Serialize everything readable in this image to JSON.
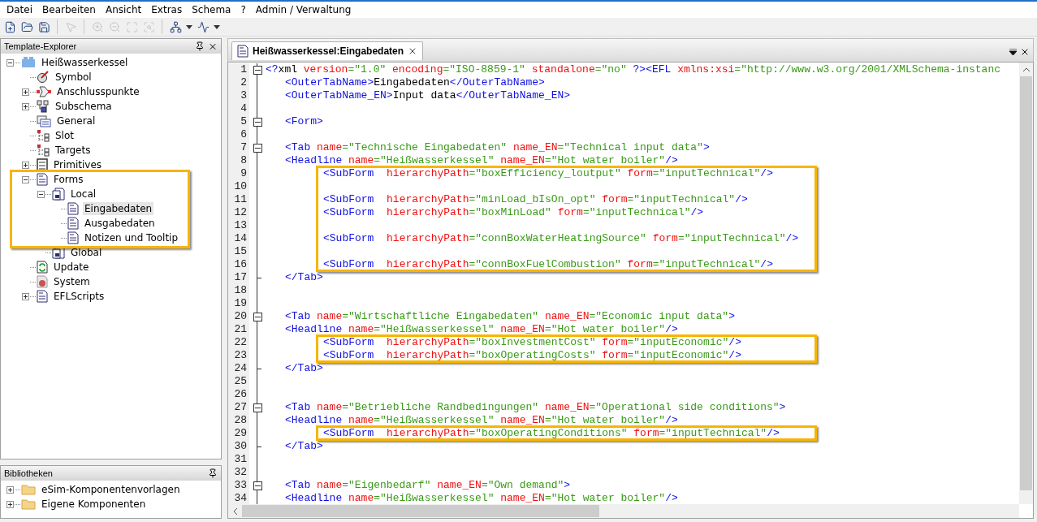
{
  "menu": [
    "Datei",
    "Bearbeiten",
    "Ansicht",
    "Extras",
    "Schema",
    "?",
    "Admin / Verwaltung"
  ],
  "toolbar": [
    {
      "kind": "new",
      "disabled": false
    },
    {
      "kind": "open",
      "disabled": false
    },
    {
      "kind": "save",
      "disabled": false
    },
    {
      "kind": "separator"
    },
    {
      "kind": "pointer",
      "disabled": true
    },
    {
      "kind": "separator"
    },
    {
      "kind": "zoom-in",
      "disabled": true
    },
    {
      "kind": "zoom-out",
      "disabled": true
    },
    {
      "kind": "fit",
      "disabled": true
    },
    {
      "kind": "zoom-area",
      "disabled": true
    },
    {
      "kind": "separator"
    },
    {
      "kind": "layout",
      "disabled": false
    },
    {
      "kind": "dropdown",
      "disabled": false
    },
    {
      "kind": "wave",
      "disabled": false
    },
    {
      "kind": "dropdown",
      "disabled": false
    }
  ],
  "explorer": {
    "title": "Template-Explorer",
    "items": [
      {
        "label": "Heißwasserkessel",
        "kind": "package",
        "expanded": true,
        "selected": false,
        "highlighted": false,
        "children": [
          {
            "label": "Symbol",
            "kind": "symbol",
            "selected": false,
            "highlighted": false
          },
          {
            "label": "Anschlusspunkte",
            "kind": "connector",
            "expanded": false,
            "selected": false,
            "highlighted": false
          },
          {
            "label": "Subschema",
            "kind": "subschema",
            "expanded": false,
            "selected": false,
            "highlighted": false
          },
          {
            "label": "General",
            "kind": "general",
            "selected": false,
            "highlighted": false
          },
          {
            "label": "Slot",
            "kind": "slot",
            "selected": false,
            "highlighted": false
          },
          {
            "label": "Targets",
            "kind": "slot",
            "selected": false,
            "highlighted": false
          },
          {
            "label": "Primitives",
            "kind": "cabinet",
            "expanded": false,
            "selected": false,
            "highlighted": false
          },
          {
            "label": "Forms",
            "kind": "form",
            "expanded": true,
            "selected": false,
            "highlighted": true,
            "children": [
              {
                "label": "Local",
                "kind": "form-set",
                "expanded": true,
                "selected": false,
                "highlighted": true,
                "children": [
                  {
                    "label": "Eingabedaten",
                    "kind": "form",
                    "selected": true,
                    "highlighted": true
                  },
                  {
                    "label": "Ausgabedaten",
                    "kind": "form",
                    "selected": false,
                    "highlighted": true
                  },
                  {
                    "label": "Notizen und Tooltip",
                    "kind": "form",
                    "selected": false,
                    "highlighted": true
                  }
                ]
              },
              {
                "label": "Global",
                "kind": "form-set",
                "selected": false,
                "highlighted": false
              }
            ]
          },
          {
            "label": "Update",
            "kind": "update",
            "selected": false,
            "highlighted": false
          },
          {
            "label": "System",
            "kind": "system",
            "selected": false,
            "highlighted": false
          },
          {
            "label": "EFLScripts",
            "kind": "form",
            "expanded": false,
            "selected": false,
            "highlighted": false
          }
        ]
      }
    ]
  },
  "libraries": {
    "title": "Bibliotheken",
    "items": [
      {
        "label": "eSim-Komponentenvorlagen",
        "expanded": false
      },
      {
        "label": "Eigene Komponenten",
        "expanded": false
      }
    ]
  },
  "editor_tab": {
    "label": "Heißwasserkessel:Eingabedaten",
    "selected": true
  },
  "code": [
    {
      "highlighted": false,
      "lines": [
        {
          "number": "1",
          "kind": "top",
          "collapsible": true,
          "block_end": false,
          "tokens": [
            {
              "kind": "tag",
              "text": "<?"
            },
            {
              "kind": "text",
              "text": "xml"
            },
            {
              "kind": "attr",
              "text": " version"
            },
            {
              "kind": "value",
              "text": "=\"1.0\""
            },
            {
              "kind": "attr",
              "text": " encoding"
            },
            {
              "kind": "value",
              "text": "=\"ISO-8859-1\""
            },
            {
              "kind": "attr",
              "text": " standalone"
            },
            {
              "kind": "value",
              "text": "=\"no\""
            },
            {
              "kind": "tag",
              "text": " ?><EFL"
            },
            {
              "kind": "attr",
              "text": " xmlns:xsi"
            },
            {
              "kind": "value",
              "text": "=\"http://www.w3.org/2001/XMLSchema-instanc"
            }
          ]
        },
        {
          "number": "2",
          "kind": "child",
          "collapsible": false,
          "block_end": false,
          "tokens": [
            {
              "kind": "tag",
              "text": "<OuterTabName>"
            },
            {
              "kind": "text",
              "text": "Eingabedaten"
            },
            {
              "kind": "tag",
              "text": "</OuterTabName>"
            }
          ]
        },
        {
          "number": "3",
          "kind": "child",
          "collapsible": false,
          "block_end": false,
          "tokens": [
            {
              "kind": "tag",
              "text": "<OuterTabName_EN>"
            },
            {
              "kind": "text",
              "text": "Input data"
            },
            {
              "kind": "tag",
              "text": "</OuterTabName_EN>"
            }
          ]
        },
        {
          "number": "4",
          "collapsible": false,
          "block_end": false
        },
        {
          "number": "5",
          "kind": "child",
          "collapsible": true,
          "block_end": false,
          "tokens": [
            {
              "kind": "tag",
              "text": "<Form>"
            }
          ]
        },
        {
          "number": "6",
          "collapsible": false,
          "block_end": false
        },
        {
          "number": "7",
          "kind": "child",
          "collapsible": true,
          "block_end": false,
          "tokens": [
            {
              "kind": "tag",
              "text": "<Tab"
            },
            {
              "kind": "attr",
              "text": " name"
            },
            {
              "kind": "value",
              "text": "=\"Technische Eingabedaten\""
            },
            {
              "kind": "attr",
              "text": " name_EN"
            },
            {
              "kind": "value",
              "text": "=\"Technical input data\""
            },
            {
              "kind": "tag",
              "text": ">"
            }
          ]
        },
        {
          "number": "8",
          "kind": "child",
          "collapsible": false,
          "block_end": false,
          "tokens": [
            {
              "kind": "tag",
              "text": "<Headline"
            },
            {
              "kind": "attr",
              "text": " name"
            },
            {
              "kind": "value",
              "text": "=\"Heißwasserkessel\""
            },
            {
              "kind": "attr",
              "text": " name_EN"
            },
            {
              "kind": "value",
              "text": "=\"Hot water boiler\""
            },
            {
              "kind": "tag",
              "text": "/>"
            }
          ]
        }
      ]
    },
    {
      "highlighted": true,
      "lines": [
        {
          "number": "9",
          "kind": "subform",
          "collapsible": false,
          "block_end": false,
          "tokens": [
            {
              "kind": "tag",
              "text": "<SubForm"
            },
            {
              "kind": "attr",
              "text": "  hierarchyPath"
            },
            {
              "kind": "value",
              "text": "=\"boxEfficiency_loutput\""
            },
            {
              "kind": "attr",
              "text": " form"
            },
            {
              "kind": "value",
              "text": "=\"inputTechnical\""
            },
            {
              "kind": "tag",
              "text": "/>"
            }
          ]
        },
        {
          "number": "10",
          "collapsible": false,
          "block_end": false
        },
        {
          "number": "11",
          "kind": "subform",
          "collapsible": false,
          "block_end": false,
          "tokens": [
            {
              "kind": "tag",
              "text": "<SubForm"
            },
            {
              "kind": "attr",
              "text": "  hierarchyPath"
            },
            {
              "kind": "value",
              "text": "=\"minLoad_bIsOn_opt\""
            },
            {
              "kind": "attr",
              "text": " form"
            },
            {
              "kind": "value",
              "text": "=\"inputTechnical\""
            },
            {
              "kind": "tag",
              "text": "/>"
            }
          ]
        },
        {
          "number": "12",
          "kind": "subform",
          "collapsible": false,
          "block_end": false,
          "tokens": [
            {
              "kind": "tag",
              "text": "<SubForm"
            },
            {
              "kind": "attr",
              "text": "  hierarchyPath"
            },
            {
              "kind": "value",
              "text": "=\"boxMinLoad\""
            },
            {
              "kind": "attr",
              "text": " form"
            },
            {
              "kind": "value",
              "text": "=\"inputTechnical\""
            },
            {
              "kind": "tag",
              "text": "/>"
            }
          ]
        },
        {
          "number": "13",
          "collapsible": false,
          "block_end": false
        },
        {
          "number": "14",
          "kind": "subform",
          "collapsible": false,
          "block_end": false,
          "tokens": [
            {
              "kind": "tag",
              "text": "<SubForm"
            },
            {
              "kind": "attr",
              "text": "  hierarchyPath"
            },
            {
              "kind": "value",
              "text": "=\"connBoxWaterHeatingSource\""
            },
            {
              "kind": "attr",
              "text": " form"
            },
            {
              "kind": "value",
              "text": "=\"inputTechnical\""
            },
            {
              "kind": "tag",
              "text": "/>"
            }
          ]
        },
        {
          "number": "15",
          "collapsible": false,
          "block_end": false
        },
        {
          "number": "16",
          "kind": "subform",
          "collapsible": false,
          "block_end": false,
          "tokens": [
            {
              "kind": "tag",
              "text": "<SubForm"
            },
            {
              "kind": "attr",
              "text": "  hierarchyPath"
            },
            {
              "kind": "value",
              "text": "=\"connBoxFuelCombustion\""
            },
            {
              "kind": "attr",
              "text": " form"
            },
            {
              "kind": "value",
              "text": "=\"inputTechnical\""
            },
            {
              "kind": "tag",
              "text": "/>"
            }
          ]
        }
      ]
    },
    {
      "highlighted": false,
      "lines": [
        {
          "number": "17",
          "kind": "child",
          "collapsible": false,
          "block_end": true,
          "tokens": [
            {
              "kind": "tag",
              "text": "</Tab>"
            }
          ]
        },
        {
          "number": "18",
          "collapsible": false,
          "block_end": false
        },
        {
          "number": "19",
          "collapsible": false,
          "block_end": false
        },
        {
          "number": "20",
          "kind": "child",
          "collapsible": true,
          "block_end": false,
          "tokens": [
            {
              "kind": "tag",
              "text": "<Tab"
            },
            {
              "kind": "attr",
              "text": " name"
            },
            {
              "kind": "value",
              "text": "=\"Wirtschaftliche Eingabedaten\""
            },
            {
              "kind": "attr",
              "text": " name_EN"
            },
            {
              "kind": "value",
              "text": "=\"Economic input data\""
            },
            {
              "kind": "tag",
              "text": ">"
            }
          ]
        },
        {
          "number": "21",
          "kind": "child",
          "collapsible": false,
          "block_end": false,
          "tokens": [
            {
              "kind": "tag",
              "text": "<Headline"
            },
            {
              "kind": "attr",
              "text": " name"
            },
            {
              "kind": "value",
              "text": "=\"Heißwasserkessel\""
            },
            {
              "kind": "attr",
              "text": " name_EN"
            },
            {
              "kind": "value",
              "text": "=\"Hot water boiler\""
            },
            {
              "kind": "tag",
              "text": "/>"
            }
          ]
        }
      ]
    },
    {
      "highlighted": true,
      "lines": [
        {
          "number": "22",
          "kind": "subform",
          "collapsible": false,
          "block_end": false,
          "tokens": [
            {
              "kind": "tag",
              "text": "<SubForm"
            },
            {
              "kind": "attr",
              "text": "  hierarchyPath"
            },
            {
              "kind": "value",
              "text": "=\"boxInvestmentCost\""
            },
            {
              "kind": "attr",
              "text": " form"
            },
            {
              "kind": "value",
              "text": "=\"inputEconomic\""
            },
            {
              "kind": "tag",
              "text": "/>"
            }
          ]
        },
        {
          "number": "23",
          "kind": "subform",
          "collapsible": false,
          "block_end": false,
          "tokens": [
            {
              "kind": "tag",
              "text": "<SubForm"
            },
            {
              "kind": "attr",
              "text": "  hierarchyPath"
            },
            {
              "kind": "value",
              "text": "=\"boxOperatingCosts\""
            },
            {
              "kind": "attr",
              "text": " form"
            },
            {
              "kind": "value",
              "text": "=\"inputEconomic\""
            },
            {
              "kind": "tag",
              "text": "/>"
            }
          ]
        }
      ]
    },
    {
      "highlighted": false,
      "lines": [
        {
          "number": "24",
          "kind": "child",
          "collapsible": false,
          "block_end": true,
          "tokens": [
            {
              "kind": "tag",
              "text": "</Tab>"
            }
          ]
        },
        {
          "number": "25",
          "collapsible": false,
          "block_end": false
        },
        {
          "number": "26",
          "collapsible": false,
          "block_end": false
        },
        {
          "number": "27",
          "kind": "child",
          "collapsible": true,
          "block_end": false,
          "tokens": [
            {
              "kind": "tag",
              "text": "<Tab"
            },
            {
              "kind": "attr",
              "text": " name"
            },
            {
              "kind": "value",
              "text": "=\"Betriebliche Randbedingungen\""
            },
            {
              "kind": "attr",
              "text": " name_EN"
            },
            {
              "kind": "value",
              "text": "=\"Operational side conditions\""
            },
            {
              "kind": "tag",
              "text": ">"
            }
          ]
        },
        {
          "number": "28",
          "kind": "child",
          "collapsible": false,
          "block_end": false,
          "tokens": [
            {
              "kind": "tag",
              "text": "<Headline"
            },
            {
              "kind": "attr",
              "text": " name"
            },
            {
              "kind": "value",
              "text": "=\"Heißwasserkessel\""
            },
            {
              "kind": "attr",
              "text": " name_EN"
            },
            {
              "kind": "value",
              "text": "=\"Hot water boiler\""
            },
            {
              "kind": "tag",
              "text": "/>"
            }
          ]
        }
      ]
    },
    {
      "highlighted": true,
      "lines": [
        {
          "number": "29",
          "kind": "subform",
          "collapsible": false,
          "block_end": false,
          "tokens": [
            {
              "kind": "tag",
              "text": "<SubForm"
            },
            {
              "kind": "attr",
              "text": "  hierarchyPath"
            },
            {
              "kind": "value",
              "text": "=\"boxOperatingConditions\""
            },
            {
              "kind": "attr",
              "text": " form"
            },
            {
              "kind": "value",
              "text": "=\"inputTechnical\""
            },
            {
              "kind": "tag",
              "text": "/>"
            }
          ]
        }
      ]
    },
    {
      "highlighted": false,
      "lines": [
        {
          "number": "30",
          "kind": "child",
          "collapsible": false,
          "block_end": true,
          "tokens": [
            {
              "kind": "tag",
              "text": "</Tab>"
            }
          ]
        },
        {
          "number": "31",
          "collapsible": false,
          "block_end": false
        },
        {
          "number": "32",
          "collapsible": false,
          "block_end": false
        },
        {
          "number": "33",
          "kind": "child",
          "collapsible": true,
          "block_end": false,
          "tokens": [
            {
              "kind": "tag",
              "text": "<Tab"
            },
            {
              "kind": "attr",
              "text": " name"
            },
            {
              "kind": "value",
              "text": "=\"Eigenbedarf\""
            },
            {
              "kind": "attr",
              "text": " name_EN"
            },
            {
              "kind": "value",
              "text": "=\"Own demand\""
            },
            {
              "kind": "tag",
              "text": ">"
            }
          ]
        },
        {
          "number": "34",
          "kind": "child",
          "collapsible": false,
          "block_end": false,
          "tokens": [
            {
              "kind": "tag",
              "text": "<Headline"
            },
            {
              "kind": "attr",
              "text": " name"
            },
            {
              "kind": "value",
              "text": "=\"Heißwasserkessel\""
            },
            {
              "kind": "attr",
              "text": " name_EN"
            },
            {
              "kind": "value",
              "text": "=\"Hot water boiler\""
            },
            {
              "kind": "tag",
              "text": "/>"
            }
          ]
        }
      ]
    }
  ]
}
